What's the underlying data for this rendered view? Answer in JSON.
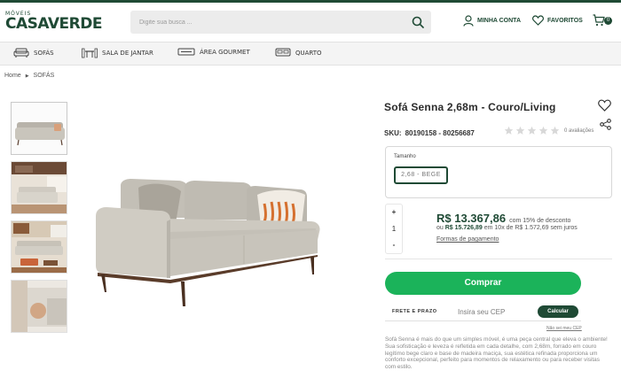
{
  "header": {
    "logo_small": "MÓVEIS",
    "logo_main": "CASAVERDE",
    "search_placeholder": "Digite sua busca ...",
    "account_label": "MINHA CONTA",
    "favorites_label": "FAVORITOS",
    "cart_count": "0"
  },
  "categories": [
    {
      "label": "SOFÁS",
      "icon": "sofa-icon"
    },
    {
      "label": "SALA DE JANTAR",
      "icon": "dining-table-icon"
    },
    {
      "label": "ÁREA GOURMET",
      "icon": "grill-icon"
    },
    {
      "label": "QUARTO",
      "icon": "bed-icon"
    }
  ],
  "breadcrumb": {
    "home": "Home",
    "current": "SOFÁS"
  },
  "product": {
    "title": "Sofá Senna 2,68m - Couro/Living",
    "sku_label": "SKU:",
    "sku_values": "80190158 - 80256687",
    "rating_stars": 0,
    "reviews": "0 avaliações",
    "variant_label": "Tamanho",
    "variant_option": "2,68 - BEGE",
    "quantity": "1",
    "price": "R$ 13.367,86",
    "price_note": "com 15% de desconto",
    "installments_prefix": "ou",
    "price_old": "R$ 15.726,89",
    "installments_suffix": "em 10x de R$ 1.572,69 sem juros",
    "payment_link": "Formas de pagamento",
    "buy_label": "Comprar",
    "shipping_label": "FRETE E PRAZO",
    "cep_placeholder": "Insira seu CEP",
    "calc_label": "Calcular",
    "cep_link": "Não sei meu CEP",
    "description": "Sofá Senna é mais do que um simples móvel, é uma peça central que eleva o ambiente! Sua sofisticação e leveza é refletida em cada detalhe, com 2,68m, forrado em couro legítimo bege claro e base de madeira maciça, sua estética refinada proporciona um conforto excepcional, perfeito para momentos de relaxamento ou para receber visitas com estilo."
  },
  "colors": {
    "brand_green": "#1f4a35",
    "buy_green": "#1bb35a",
    "sofa_beige": "#c9c5bc"
  }
}
